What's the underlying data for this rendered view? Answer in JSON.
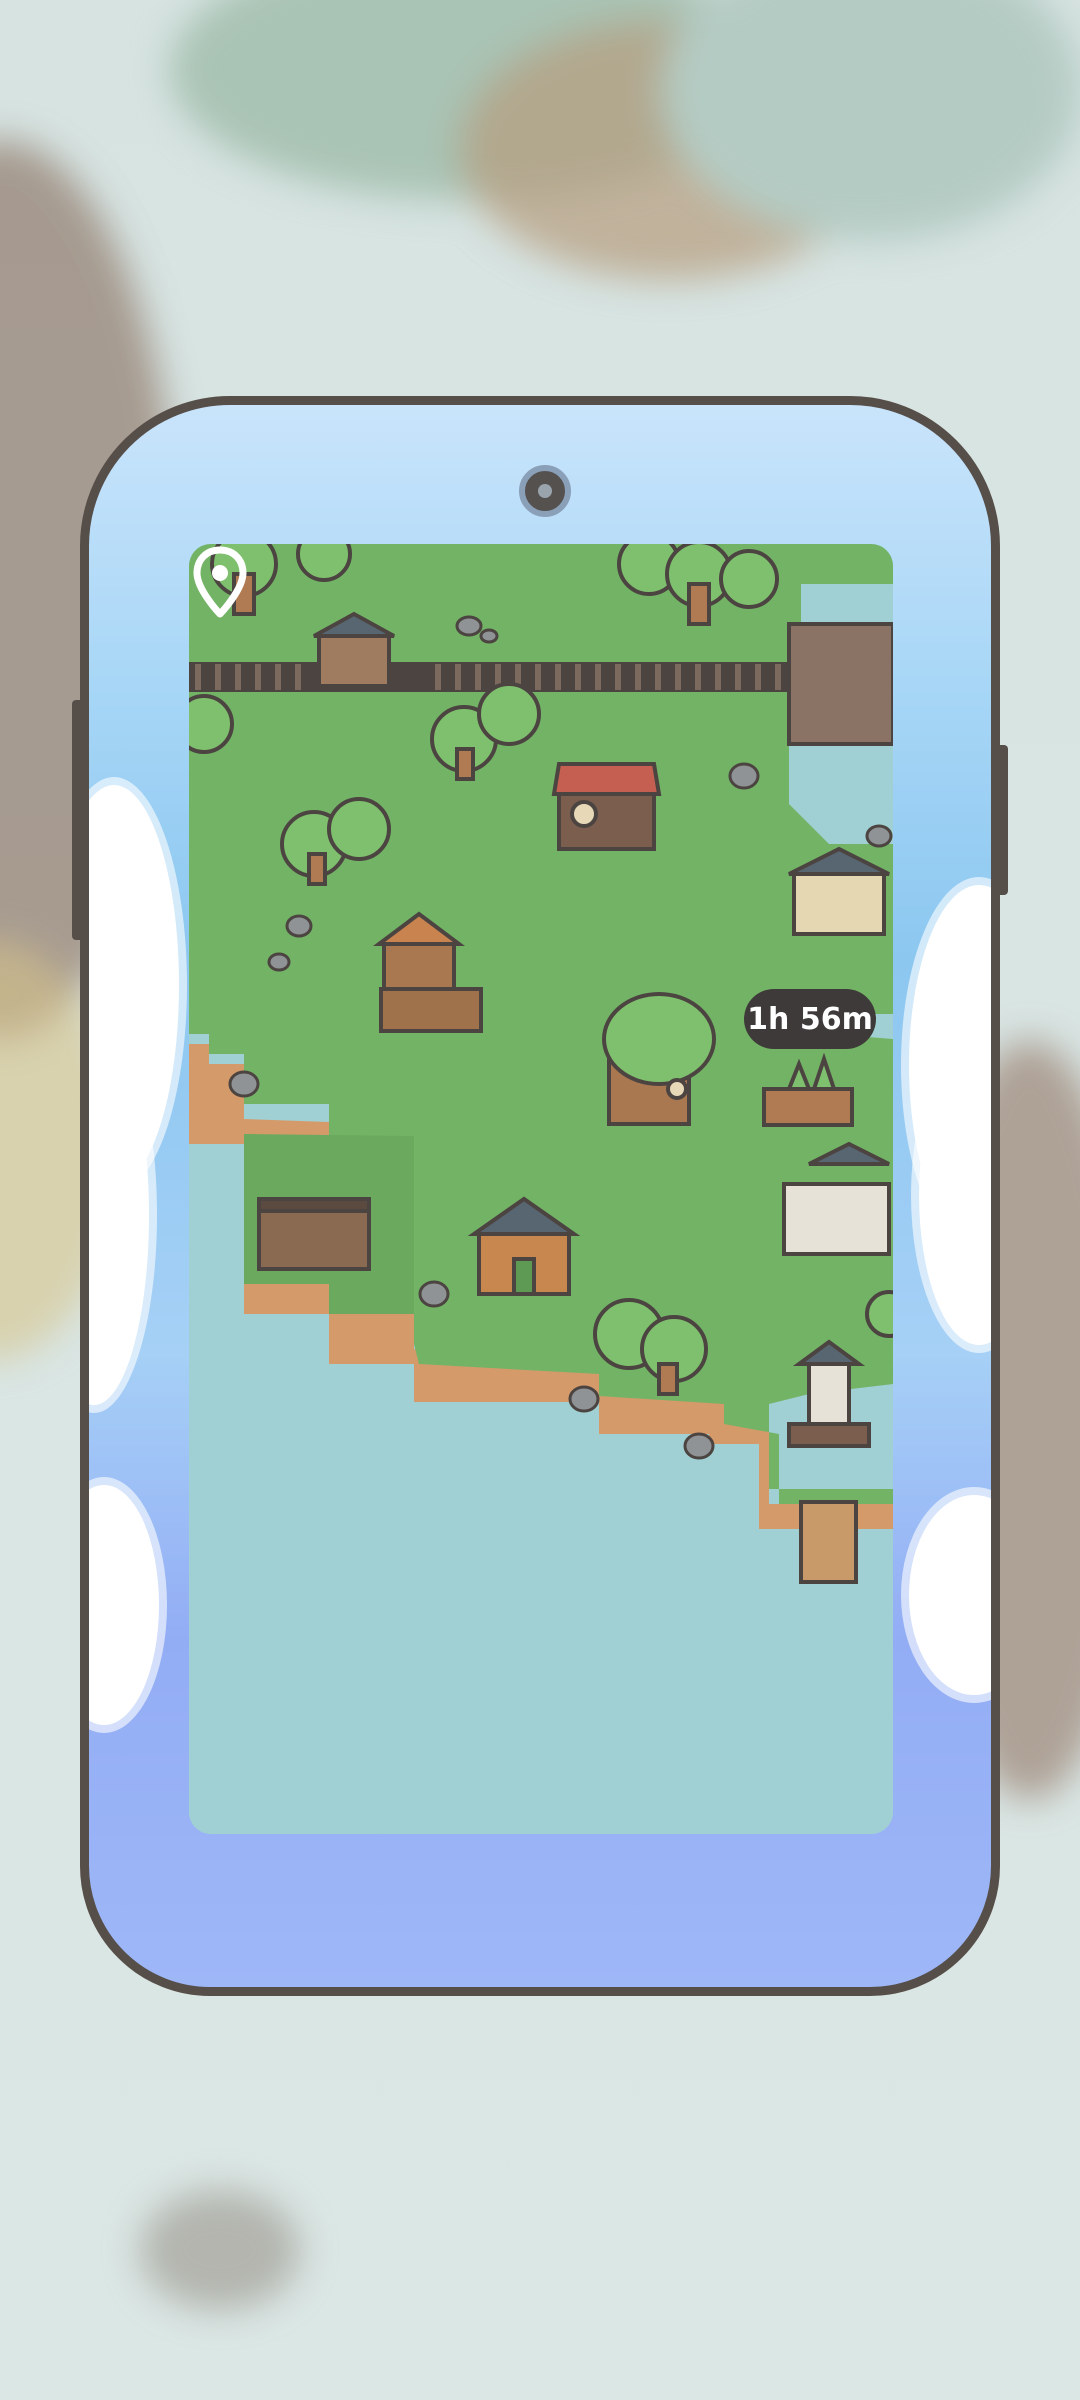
{
  "game": {
    "timer_text": "1h 56m"
  },
  "icons": {
    "camera": "camera-lens-icon",
    "location": "location-pin-icon"
  },
  "colors": {
    "phone_border": "#564e49",
    "grass": "#73b366",
    "water": "#a0d0d3",
    "timer_bg": "#3e3a39"
  }
}
